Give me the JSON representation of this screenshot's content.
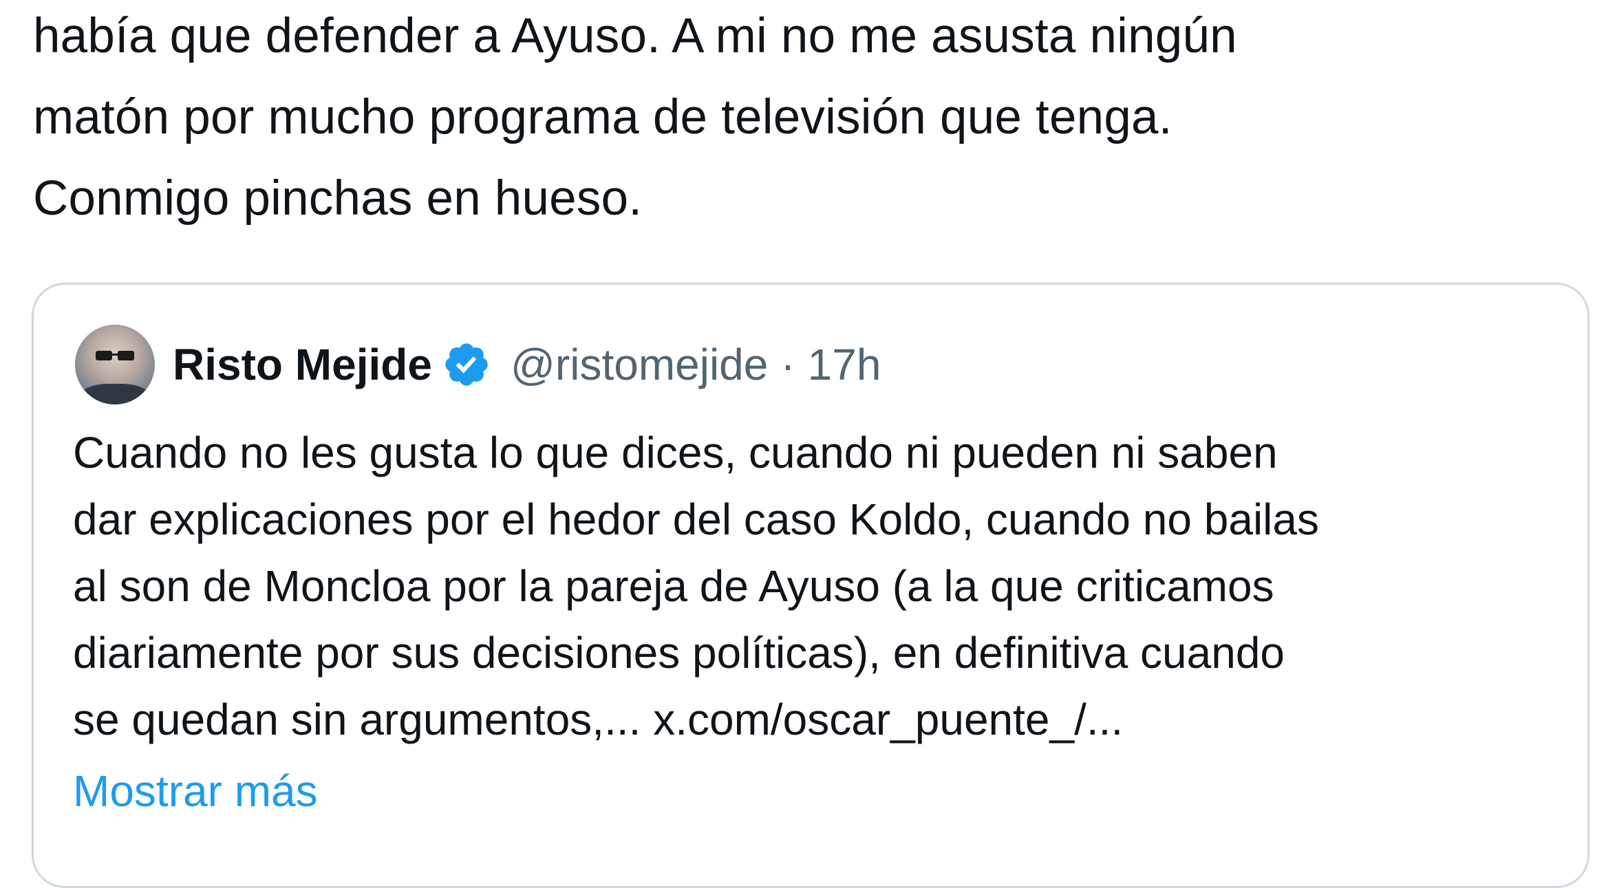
{
  "tweet": {
    "text": "había que defender a Ayuso. A mi no me asusta ningún\nmatón por mucho programa de televisión que tenga.\nConmigo pinchas en hueso."
  },
  "quoted_tweet": {
    "author_name": "Risto Mejide",
    "handle": "@ristomejide",
    "separator": "·",
    "time": "17h",
    "text": "Cuando no les gusta lo que dices, cuando ni pueden ni saben\ndar explicaciones por el hedor del caso Koldo, cuando no bailas\nal son de Moncloa por la pareja de Ayuso (a la que criticamos\ndiariamente por sus decisiones políticas), en definitiva cuando\nse quedan sin argumentos,... x.com/oscar_puente_/...",
    "show_more_label": "Mostrar más",
    "avatar_icon": "avatar",
    "verified_icon": "verified-badge-icon"
  },
  "colors": {
    "text": "#0f1419",
    "secondary_text": "#536471",
    "link": "#1d9bf0",
    "verified": "#1d9bf0",
    "border": "#cfd9de"
  }
}
